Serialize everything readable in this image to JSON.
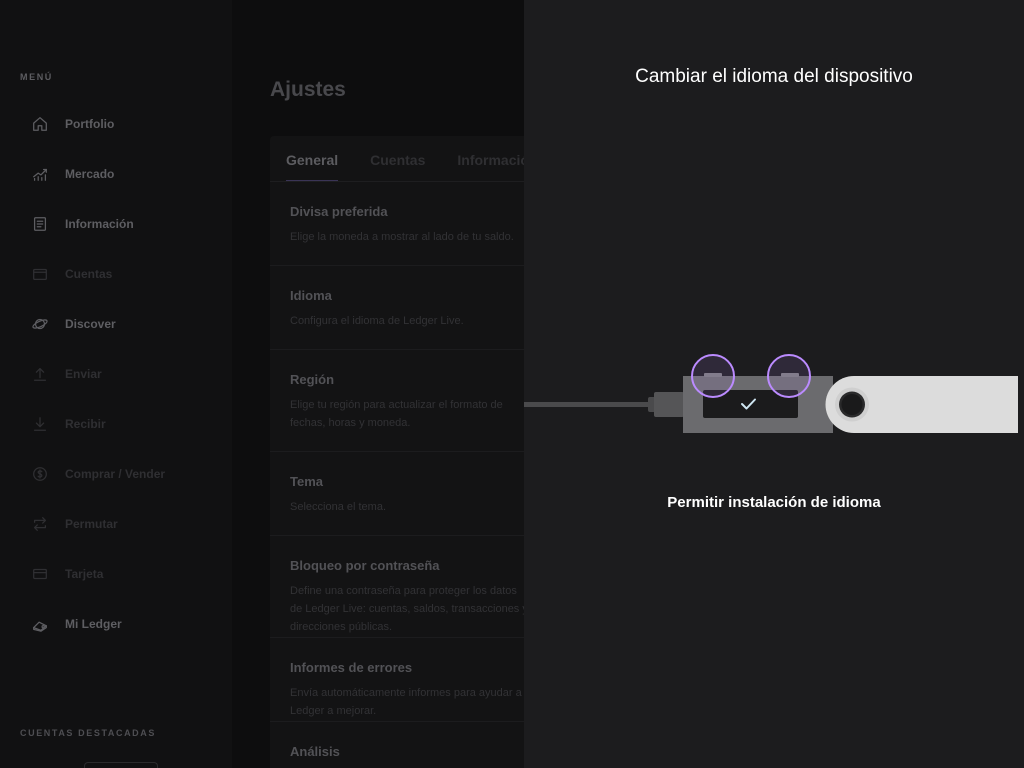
{
  "sidebar": {
    "menu_heading": "MENÚ",
    "items": [
      {
        "label": "Portfolio",
        "icon": "home-icon"
      },
      {
        "label": "Mercado",
        "icon": "market-chart-icon"
      },
      {
        "label": "Información",
        "icon": "news-icon"
      },
      {
        "label": "Cuentas",
        "icon": "wallet-icon"
      },
      {
        "label": "Discover",
        "icon": "planet-icon"
      },
      {
        "label": "Enviar",
        "icon": "send-arrow-up-icon"
      },
      {
        "label": "Recibir",
        "icon": "receive-arrow-down-icon"
      },
      {
        "label": "Comprar / Vender",
        "icon": "dollar-coin-icon"
      },
      {
        "label": "Permutar",
        "icon": "swap-arrows-icon"
      },
      {
        "label": "Tarjeta",
        "icon": "card-icon"
      },
      {
        "label": "Mi Ledger",
        "icon": "ledger-device-icon"
      }
    ],
    "starred_heading": "CUENTAS DESTACADAS"
  },
  "main": {
    "page_title": "Ajustes",
    "tabs": [
      {
        "label": "General",
        "active": true
      },
      {
        "label": "Cuentas",
        "active": false
      },
      {
        "label": "Información",
        "active": false
      }
    ],
    "settings": [
      {
        "title": "Divisa preferida",
        "description": "Elige la moneda a mostrar al lado de tu saldo."
      },
      {
        "title": "Idioma",
        "description": "Configura el idioma de Ledger Live."
      },
      {
        "title": "Región",
        "description": "Elige tu región para actualizar el formato de fechas, horas y moneda."
      },
      {
        "title": "Tema",
        "description": "Selecciona el tema."
      },
      {
        "title": "Bloqueo por contraseña",
        "description": "Define una contraseña para proteger los datos de Ledger Live: cuentas, saldos, transacciones y direcciones públicas."
      },
      {
        "title": "Informes de errores",
        "description": "Envía automáticamente informes para ayudar a Ledger a mejorar."
      },
      {
        "title": "Análisis",
        "description": ""
      }
    ]
  },
  "drawer": {
    "title": "Cambiar el idioma del dispositivo",
    "caption": "Permitir instalación de idioma",
    "device_screen_icon": "checkmark-icon",
    "highlight_color": "#bb8bff",
    "device_body_color": "#6b6b6e",
    "device_cover_color": "#dcdcdc"
  }
}
